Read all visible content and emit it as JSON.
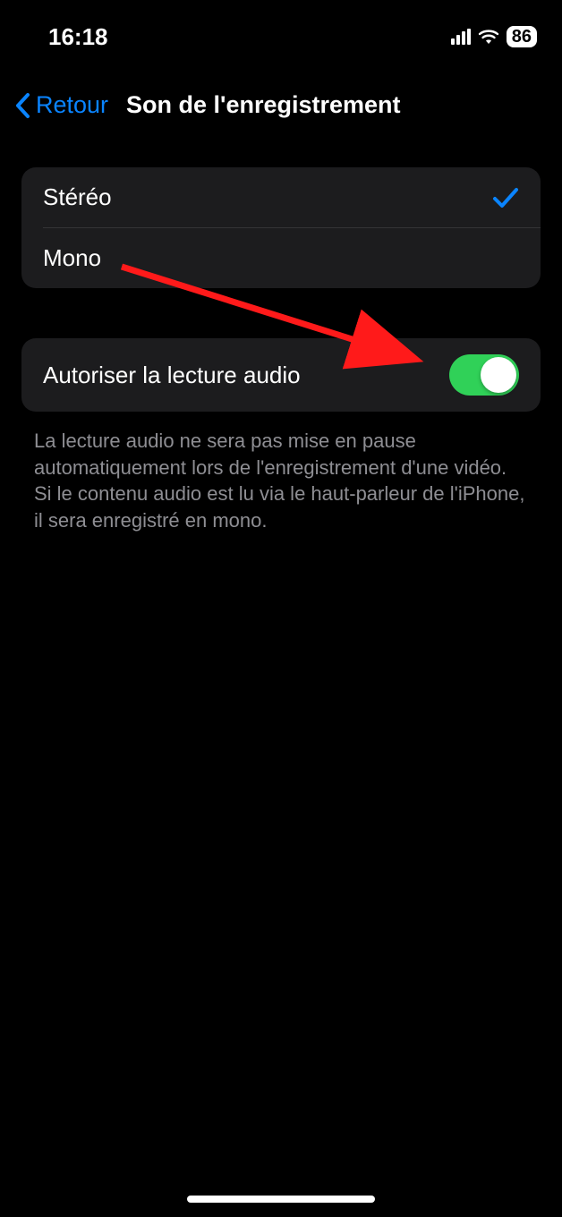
{
  "statusBar": {
    "time": "16:18",
    "batteryPercent": "86"
  },
  "nav": {
    "backLabel": "Retour",
    "title": "Son de l'enregistrement"
  },
  "audioModes": {
    "option1": "Stéréo",
    "option2": "Mono",
    "selectedIndex": 0
  },
  "toggleSection": {
    "label": "Autoriser la lecture audio",
    "enabled": true
  },
  "footer": {
    "text": "La lecture audio ne sera pas mise en pause automatiquement lors de l'enregistrement d'une vidéo. Si le contenu audio est lu via le haut-parleur de l'iPhone, il sera enregistré en mono."
  }
}
